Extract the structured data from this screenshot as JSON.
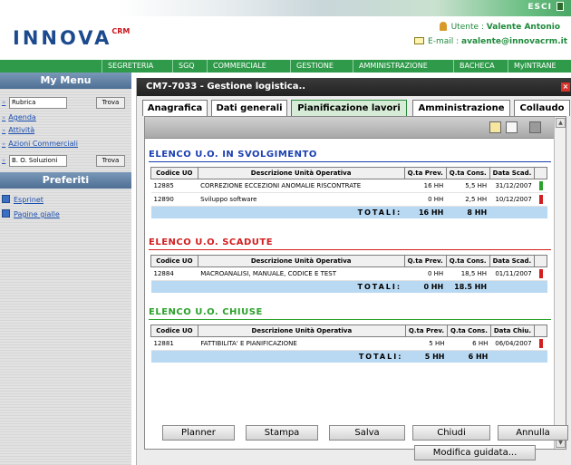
{
  "header": {
    "logo_text": "INNOVA",
    "logo_suffix": "CRM",
    "esci_label": "ESCI",
    "user_label": "Utente : ",
    "user_name": "Valente Antonio",
    "email_label": "E-mail : ",
    "email_value": "avalente@innovacrm.it"
  },
  "nav": [
    "SEGRETERIA",
    "SGQ",
    "COMMERCIALE",
    "GESTIONE",
    "AMMINISTRAZIONE",
    "BACHECA",
    "MyINTRANE"
  ],
  "sidebar": {
    "menu_title": "My Menu",
    "search1_value": "Rubrica",
    "search1_button": "Trova",
    "links": [
      "Agenda",
      "Attività",
      "Azioni Commerciali"
    ],
    "search2_value": "B. O. Soluzioni",
    "search2_button": "Trova",
    "fav_title": "Preferiti",
    "favorites": [
      "Esprinet",
      "Pagine gialle"
    ]
  },
  "window": {
    "title": "CM7-7033 - Gestione logistica..",
    "tabs": [
      "Anagrafica",
      "Dati generali",
      "Pianificazione lavori",
      "Amministrazione",
      "Collaudo"
    ],
    "active_tab": "Pianificazione lavori"
  },
  "sections": [
    {
      "title": "ELENCO U.O. IN SVOLGIMENTO",
      "color": "#1a3fb0",
      "columns": [
        "Codice UO",
        "Descrizione Unità Operativa",
        "Q.ta Prev.",
        "Q.ta Cons.",
        "Data Scad."
      ],
      "rows": [
        {
          "code": "12885",
          "desc": "CORREZIONE ECCEZIONI ANOMALIE RISCONTRATE",
          "prev": "16 HH",
          "cons": "5,5 HH",
          "date": "31/12/2007",
          "status_color": "#2aa12a"
        },
        {
          "code": "12890",
          "desc": "Sviluppo software",
          "prev": "0 HH",
          "cons": "2,5 HH",
          "date": "10/12/2007",
          "status_color": "#d21e1e"
        }
      ],
      "total_label": "TOTALI:",
      "total_prev": "16 HH",
      "total_cons": "8 HH"
    },
    {
      "title": "ELENCO U.O. SCADUTE",
      "color": "#d21e1e",
      "columns": [
        "Codice UO",
        "Descrizione Unità Operativa",
        "Q.ta Prev.",
        "Q.ta Cons.",
        "Data Scad."
      ],
      "rows": [
        {
          "code": "12884",
          "desc": "MACROANALISI, MANUALE, CODICE E TEST",
          "prev": "0 HH",
          "cons": "18,5 HH",
          "date": "01/11/2007",
          "status_color": "#d21e1e"
        }
      ],
      "total_label": "TOTALI:",
      "total_prev": "0 HH",
      "total_cons": "18.5 HH"
    },
    {
      "title": "ELENCO U.O. CHIUSE",
      "color": "#2aa12a",
      "columns": [
        "Codice UO",
        "Descrizione Unità Operativa",
        "Q.ta Prev.",
        "Q.ta Cons.",
        "Data Chiu."
      ],
      "rows": [
        {
          "code": "12881",
          "desc": "FATTIBILITA' E PIANIFICAZIONE",
          "prev": "5 HH",
          "cons": "6 HH",
          "date": "06/04/2007",
          "status_color": "#d21e1e"
        }
      ],
      "total_label": "TOTALI:",
      "total_prev": "5 HH",
      "total_cons": "6 HH"
    }
  ],
  "buttons": [
    "Planner",
    "Stampa",
    "Salva",
    "Chiudi",
    "Annulla"
  ],
  "guided_button": "Modifica guidata..."
}
